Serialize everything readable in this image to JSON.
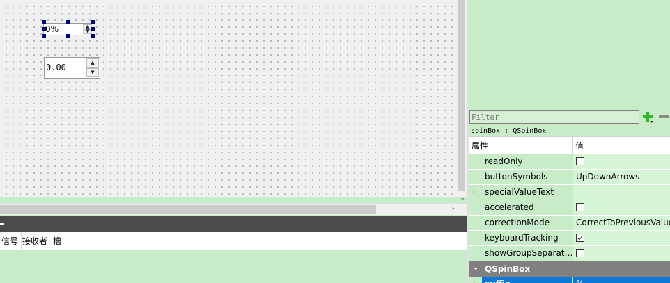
{
  "canvas": {
    "spinbox_selected": {
      "value": "0%"
    },
    "spinbox_double": {
      "value": "0.00"
    }
  },
  "signal_slot": {
    "columns": [
      "信号",
      "接收者",
      "槽"
    ]
  },
  "property_editor": {
    "filter_placeholder": "Filter",
    "object_label": "spinBox : QSpinBox",
    "header_property": "属性",
    "header_value": "值",
    "rows": [
      {
        "name": "readOnly",
        "type": "checkbox",
        "checked": false,
        "expandable": false
      },
      {
        "name": "buttonSymbols",
        "type": "text",
        "value": "UpDownArrows",
        "expandable": false
      },
      {
        "name": "specialValueText",
        "type": "text",
        "value": "",
        "expandable": true
      },
      {
        "name": "accelerated",
        "type": "checkbox",
        "checked": false,
        "expandable": false
      },
      {
        "name": "correctionMode",
        "type": "text",
        "value": "CorrectToPreviousValue",
        "expandable": false
      },
      {
        "name": "keyboardTracking",
        "type": "checkbox",
        "checked": true,
        "expandable": false
      },
      {
        "name": "showGroupSeparat…",
        "type": "checkbox",
        "checked": false,
        "expandable": false
      }
    ],
    "group": {
      "label": "QSpinBox"
    },
    "selected_row": {
      "name": "suffix",
      "value": "%"
    }
  },
  "colors": {
    "panel_green": "#c8ecc8",
    "selection_blue": "#0a78d7",
    "group_gray": "#808080",
    "handle_navy": "#000080"
  }
}
